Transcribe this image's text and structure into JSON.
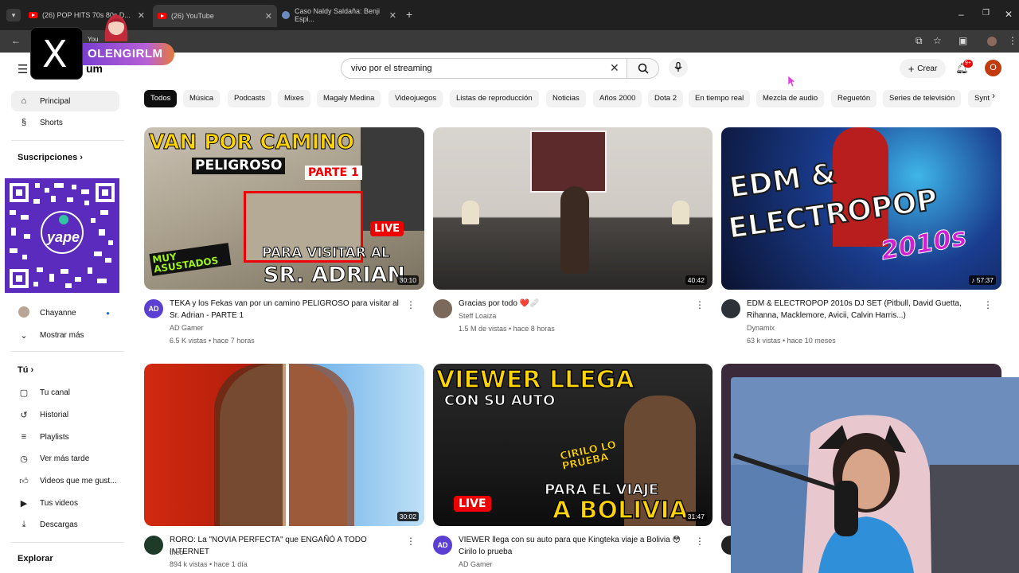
{
  "browser": {
    "tabs": [
      {
        "label": "(26) POP HITS 70s 80s D..."
      },
      {
        "label": "(26) YouTube"
      },
      {
        "label": "Caso Naldy Saldaña: Benji Espi..."
      }
    ]
  },
  "overlay": {
    "streamer_tag": "OLENGIRLM",
    "x_logo": "X",
    "mini_label": "You"
  },
  "header": {
    "logo_suffix": "um",
    "search_value": "vivo por el streaming",
    "create_label": "Crear",
    "notif_badge": "9+",
    "avatar_letter": "O"
  },
  "sidebar": {
    "top": [
      {
        "label": "Principal",
        "icon": "home-icon"
      },
      {
        "label": "Shorts",
        "icon": "shorts-icon"
      }
    ],
    "subs_title": "Suscripciones",
    "subs": [
      {
        "label": "Chayanne"
      },
      {
        "label": "Mostrar más"
      }
    ],
    "you_title": "Tú",
    "you_items": [
      {
        "label": "Tu canal",
        "icon": "channel-icon"
      },
      {
        "label": "Historial",
        "icon": "history-icon"
      },
      {
        "label": "Playlists",
        "icon": "playlists-icon"
      },
      {
        "label": "Ver más tarde",
        "icon": "clock-icon"
      },
      {
        "label": "Videos que me gust...",
        "icon": "thumbs-up-icon"
      },
      {
        "label": "Tus videos",
        "icon": "your-videos-icon"
      },
      {
        "label": "Descargas",
        "icon": "download-icon"
      }
    ],
    "explore_title": "Explorar",
    "qr_label": "yape"
  },
  "chips": [
    "Todos",
    "Música",
    "Podcasts",
    "Mixes",
    "Magaly Medina",
    "Videojuegos",
    "Listas de reproducción",
    "Noticias",
    "Años 2000",
    "Dota 2",
    "En tiempo real",
    "Mezcla de audio",
    "Reguetón",
    "Series de televisión",
    "Synt"
  ],
  "videos": [
    {
      "title": "TEKA y los Fekas van por un camino PELIGROSO para visitar al Sr. Adrian - PARTE 1",
      "channel": "AD Gamer",
      "stats": "6.5 K vistas • hace 7 horas",
      "duration": "30:10",
      "thumb_lines": [
        "VAN POR CAMINO",
        "PELIGROSO",
        "PARTE 1",
        "MUY ASUSTADOS",
        "PARA VISITAR AL",
        "SR. ADRIAN",
        "LIVE"
      ]
    },
    {
      "title": "Gracias por todo ❤️🩹",
      "channel": "Steff Loaiza",
      "stats": "1.5 M de vistas • hace 8 horas",
      "duration": "40:42"
    },
    {
      "title": "EDM & ELECTROPOP 2010s DJ SET (Pitbull, David Guetta, Rihanna, Macklemore, Avicii, Calvin Harris...)",
      "channel": "Dynamix",
      "stats": "63 k vistas • hace 10 meses",
      "duration": "♪ 57:37",
      "thumb_lines": [
        "EDM &",
        "ELECTROPOP",
        "2010s"
      ]
    },
    {
      "title": "RORO: La \"NOVIA PERFECTA\" que ENGAÑÓ A TODO INTERNET",
      "channel": "theo",
      "stats": "894 k vistas • hace 1 día",
      "duration": "30:02"
    },
    {
      "title": "VIEWER llega con su auto para que Kingteka viaje a Bolivia 😳 Cirilo lo prueba",
      "channel": "AD Gamer",
      "stats": "",
      "duration": "31:47",
      "thumb_lines": [
        "VIEWER LLEGA",
        "CON SU AUTO",
        "CIRILO LO PRUEBA",
        "PARA EL VIAJE",
        "A BOLIVIA",
        "LIVE"
      ]
    }
  ]
}
